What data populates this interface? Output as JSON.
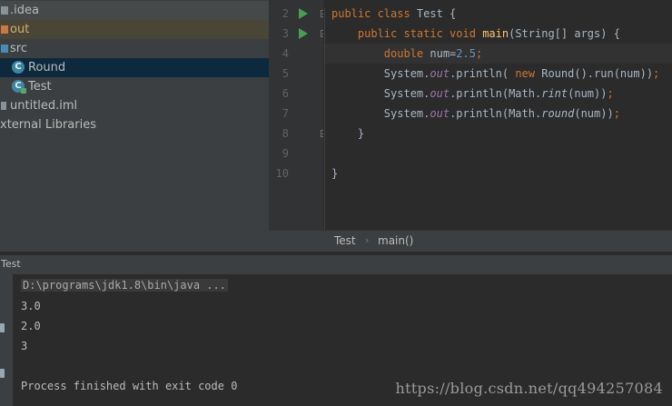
{
  "project_tree": {
    "items": [
      {
        "label": ".idea"
      },
      {
        "label": "out"
      },
      {
        "label": "src"
      },
      {
        "label": "Round"
      },
      {
        "label": "Test"
      },
      {
        "label": "untitled.iml"
      },
      {
        "label": "xternal Libraries"
      }
    ],
    "class_icon_letter": "C"
  },
  "editor": {
    "line_numbers": [
      "2",
      "3",
      "4",
      "5",
      "6",
      "7",
      "8",
      "9",
      "10"
    ]
  },
  "breadcrumb": {
    "items": [
      "Test",
      "main()"
    ],
    "separator": "›"
  },
  "run_panel": {
    "title": "Test",
    "output": {
      "command": "D:\\programs\\jdk1.8\\bin\\java ...",
      "lines": [
        "3.0",
        "2.0",
        "3"
      ],
      "exit_message": "Process finished with exit code 0"
    }
  },
  "watermark": "https://blog.csdn.net/qq494257084",
  "colors": {
    "keyword": "#cc7832",
    "method": "#ffc66d",
    "number": "#6897bb",
    "static_field": "#9876aa",
    "selection": "#0d293e",
    "run_arrow": "#499c54"
  }
}
